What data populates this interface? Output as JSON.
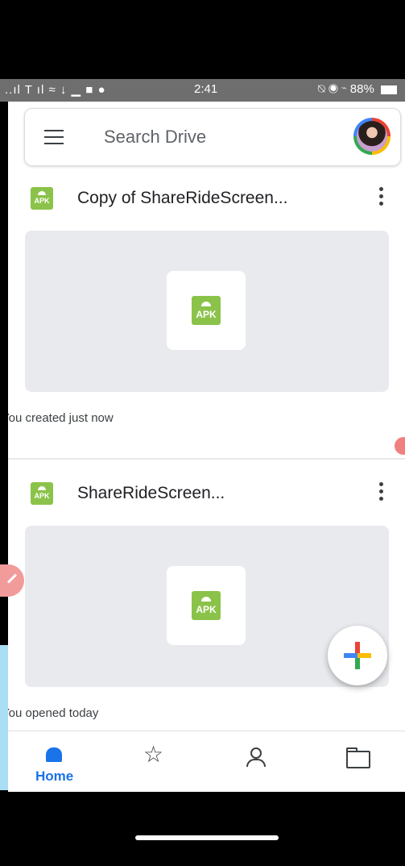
{
  "status_bar": {
    "left_icons": "..ıl T ıl ≈ ↓ ▁ ■ ●",
    "time": "2:41",
    "right_icons": "⍉ ◉ ⌁",
    "battery": "88%"
  },
  "search": {
    "placeholder": "Search Drive"
  },
  "files": [
    {
      "name": "Copy of ShareRideScreen...",
      "type_badge": "APK",
      "activity": "You created just now"
    },
    {
      "name": "ShareRideScreen...",
      "type_badge": "APK",
      "activity": "You opened today"
    }
  ],
  "bottom_nav": {
    "home_label": "Home",
    "icons": [
      "home-icon",
      "star-icon",
      "people-icon",
      "folder-icon"
    ]
  },
  "colors": {
    "accent": "#1a73e8",
    "apk_green": "#8bc34a",
    "preview_bg": "#e8eaed"
  }
}
